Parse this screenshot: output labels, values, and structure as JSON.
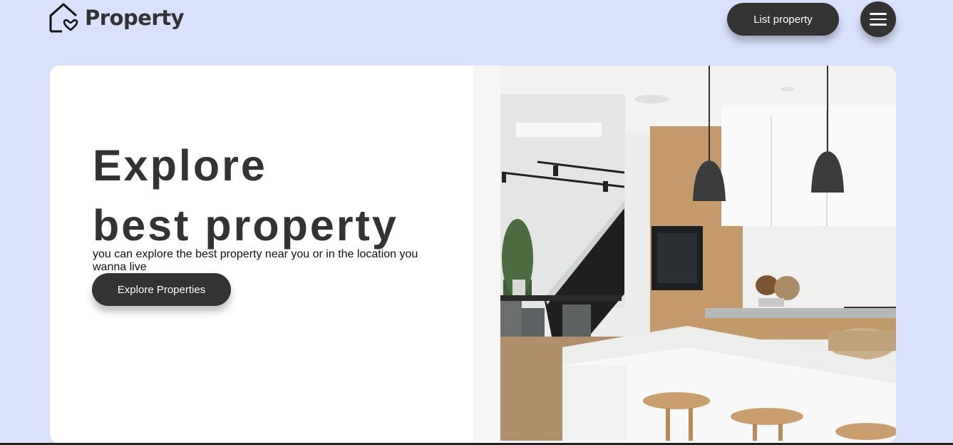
{
  "header": {
    "logo_text": "Property",
    "list_property_label": "List property"
  },
  "hero": {
    "title_line1": "Explore",
    "title_line2": "best property",
    "description": "you can explore the best property near you or in the location you wanna live",
    "explore_button_label": "Explore Properties"
  },
  "icons": {
    "logo": "house-heart-icon",
    "menu": "hamburger-menu-icon"
  },
  "colors": {
    "background": "#d9e1fd",
    "button": "#333333",
    "card": "#ffffff"
  }
}
